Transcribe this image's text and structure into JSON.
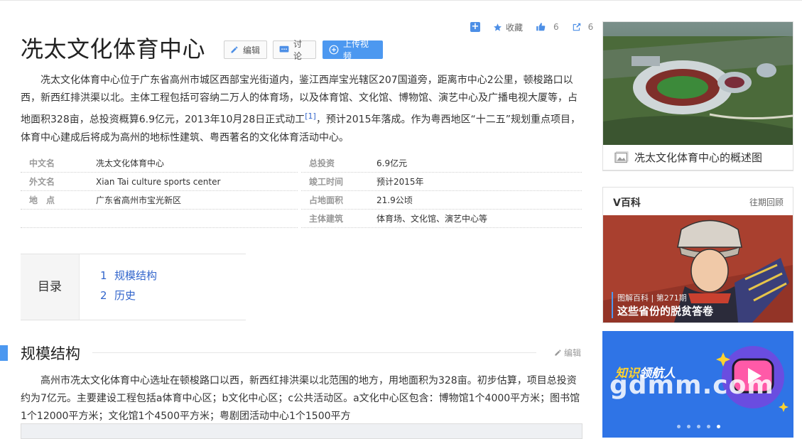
{
  "actions": {
    "favorite_label": "收藏",
    "like_count": "6",
    "share_count": "6"
  },
  "title": "冼太文化体育中心",
  "title_buttons": {
    "edit": "编辑",
    "discuss": "讨论",
    "upload_video": "上传视频"
  },
  "intro": "冼太文化体育中心位于广东省高州市城区西部宝光街道内，鉴江西岸宝光辖区207国道旁，距离市中心2公里，顿梭路口以西，新西红排洪渠以北。主体工程包括可容纳二万人的体育场，以及体育馆、文化馆、博物馆、演艺中心及广播电视大厦等，占地面积328亩，总投资概算6.9亿元，2013年10月28日正式动工",
  "intro_ref": "[1]",
  "intro_tail": "，预计2015年落成。作为粤西地区“十二五”规划重点项目，体育中心建成后将成为高州的地标性建筑、粤西著名的文化体育活动中心。",
  "basic_info": {
    "left": [
      {
        "key": "中文名",
        "value": "冼太文化体育中心"
      },
      {
        "key": "外文名",
        "value": "Xian Tai culture sports center"
      },
      {
        "key": "地　点",
        "value": "广东省高州市宝光新区"
      }
    ],
    "right": [
      {
        "key": "总投资",
        "value": "6.9亿元"
      },
      {
        "key": "竣工时间",
        "value": "预计2015年"
      },
      {
        "key": "占地面积",
        "value": "21.9公顷"
      },
      {
        "key": "主体建筑",
        "value": "体育场、文化馆、演艺中心等"
      }
    ]
  },
  "catalog": {
    "label": "目录",
    "items": [
      {
        "num": "1",
        "text": "规模结构"
      },
      {
        "num": "2",
        "text": "历史"
      }
    ]
  },
  "section": {
    "title": "规模结构",
    "edit": "编辑",
    "body": "高州市冼太文化体育中心选址在顿梭路口以西，新西红排洪渠以北范围的地方，用地面积为328亩。初步估算，项目总投资约为7亿元。主要建设工程包括a体育中心区；b文化中心区；c公共活动区。a文化中心区包含：博物馆1个4000平方米；图书馆1个12000平方米；文化馆1个4500平方米；粤剧团活动中心1个1500平方"
  },
  "sidebar": {
    "overview_caption": "冼太文化体育中心的概述图",
    "vbaike": {
      "header": "V百科",
      "more": "往期回顾",
      "sub": "图解百科 | 第271期",
      "title": "这些省份的脱贫答卷"
    },
    "promo": {
      "line_yellow": "知识",
      "line_white": "领航人"
    }
  },
  "watermark": "gdmm.com",
  "colors": {
    "accent": "#4c98f0",
    "link": "#3366cc"
  }
}
